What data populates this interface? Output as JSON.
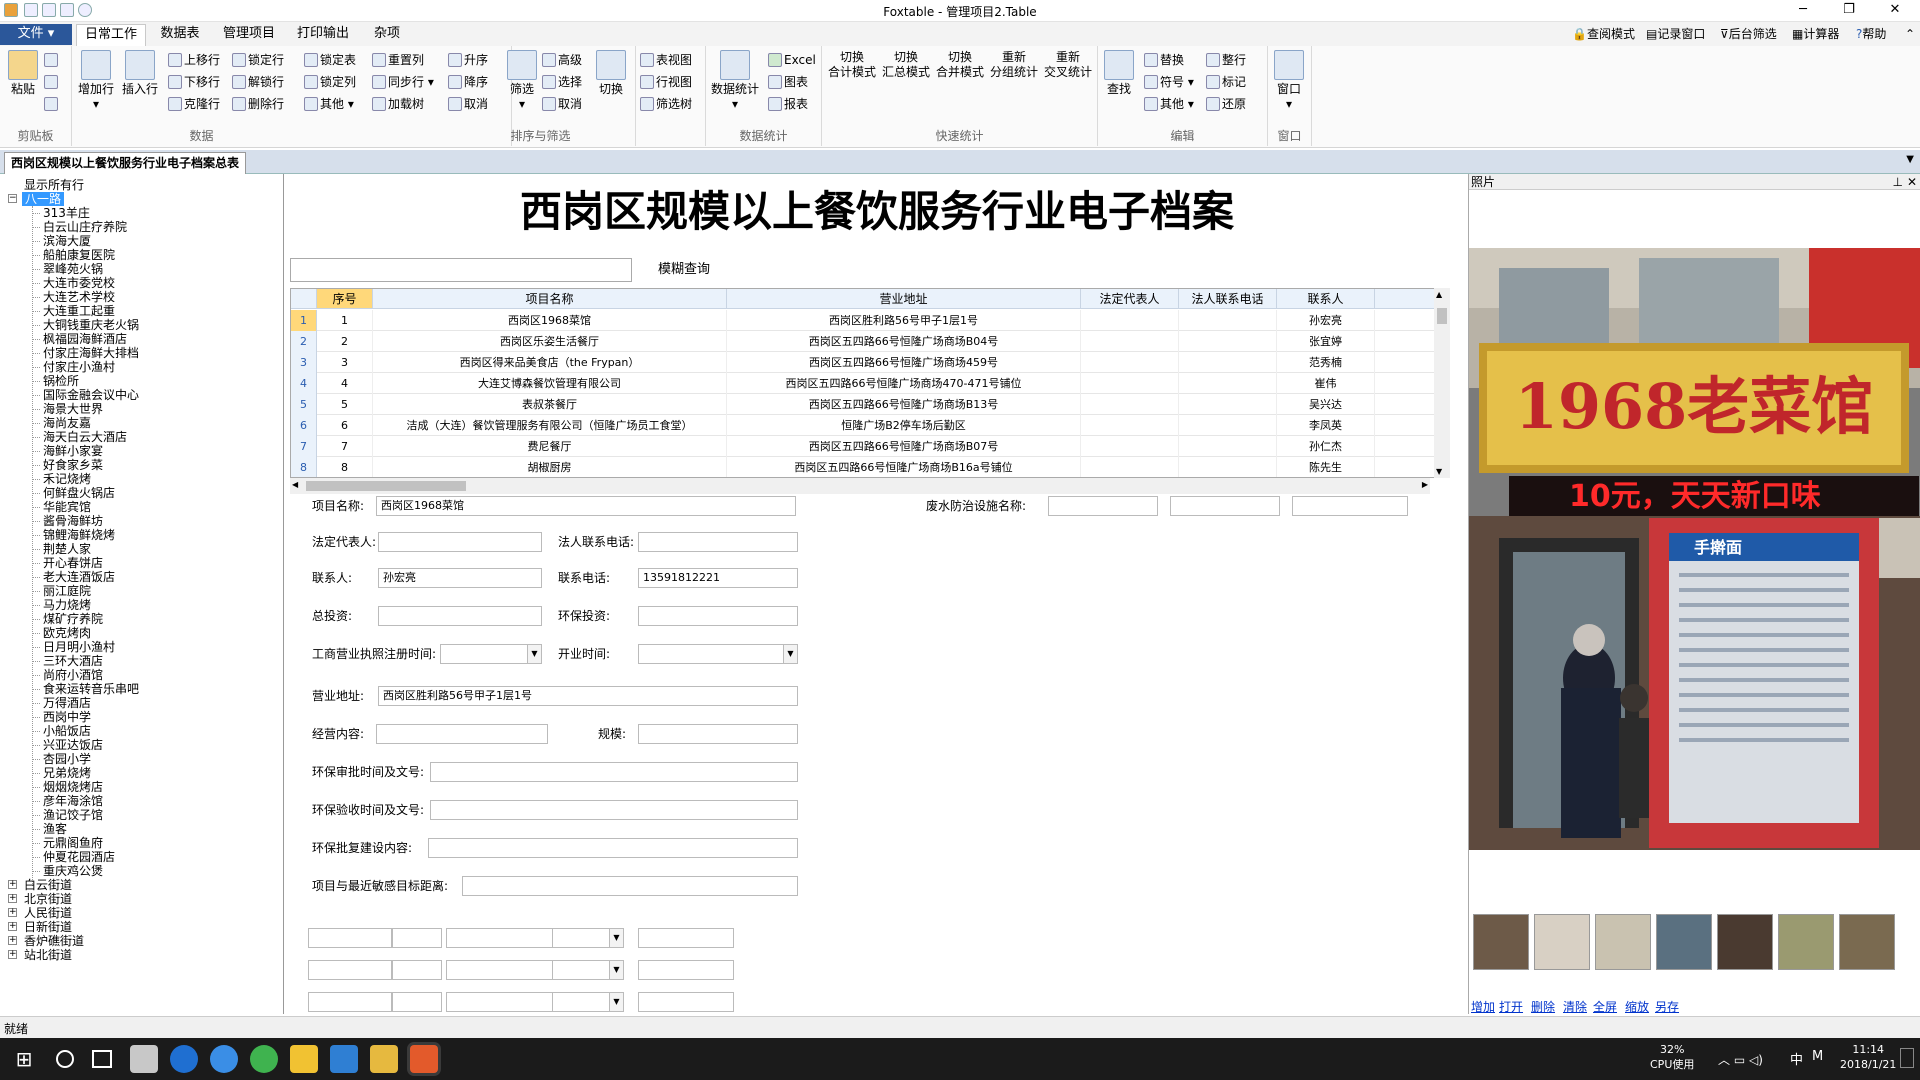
{
  "window": {
    "title": "Foxtable - 管理项目2.Table"
  },
  "tabs": {
    "file": "文件",
    "items": [
      "日常工作",
      "数据表",
      "管理项目",
      "打印输出",
      "杂项"
    ]
  },
  "topright": [
    "查阅模式",
    "记录窗口",
    "后台筛选",
    "计算器",
    "帮助"
  ],
  "ribbon": {
    "clipboard": {
      "label": "剪贴板",
      "paste": "粘贴"
    },
    "data": {
      "label": "数据",
      "add": "增加行",
      "insert": "插入行",
      "items": [
        "上移行",
        "锁定行",
        "锁定表",
        "重置列",
        "下移行",
        "解锁行",
        "锁定列",
        "同步行",
        "克隆行",
        "删除行",
        "其他",
        "加载树"
      ]
    },
    "sort": {
      "label": "排序与筛选",
      "items": [
        "升序",
        "降序",
        "取消",
        "高级",
        "选择",
        "取消"
      ],
      "filter": "筛选",
      "toggle": "切换"
    },
    "view": {
      "items": [
        "表视图",
        "行视图",
        "筛选树"
      ]
    },
    "stats": {
      "label": "数据统计",
      "main": "数据统计",
      "items": [
        "Excel",
        "图表",
        "报表"
      ]
    },
    "quick": {
      "label": "快速统计",
      "btns": [
        "切换\n合计模式",
        "切换\n汇总模式",
        "切换\n合并模式",
        "重新\n分组统计",
        "重新\n交叉统计"
      ]
    },
    "edit": {
      "label": "编辑",
      "find": "查找",
      "items": [
        "替换",
        "整行",
        "符号",
        "标记",
        "其他",
        "还原"
      ]
    },
    "window": {
      "label": "窗口",
      "btn": "窗口"
    }
  },
  "doc_tab": "西岗区规模以上餐饮服务行业电子档案总表",
  "tree": {
    "show_all": "显示所有行",
    "selected": "八一路",
    "children": [
      "313羊庄",
      "白云山庄疗养院",
      "滨海大厦",
      "船舶康复医院",
      "翠峰苑火锅",
      "大连市委党校",
      "大连艺术学校",
      "大连重工起重",
      "大铜钱重庆老火锅",
      "枫福园海鲜酒店",
      "付家庄海鲜大排档",
      "付家庄小渔村",
      "锅检所",
      "国际金融会议中心",
      "海景大世界",
      "海尚友嘉",
      "海天白云大酒店",
      "海鲜小家宴",
      "好食家乡菜",
      "禾记烧烤",
      "何鲜盘火锅店",
      "华能宾馆",
      "酱骨海鲜坊",
      "锦鲤海鲜烧烤",
      "荆楚人家",
      "开心春饼店",
      "老大连酒饭店",
      "丽江庭院",
      "马力烧烤",
      "煤矿疗养院",
      "欧克烤肉",
      "日月明小渔村",
      "三环大酒店",
      "尚府小酒馆",
      "食来运转音乐串吧",
      "万得酒店",
      "西岗中学",
      "小船饭店",
      "兴亚达饭店",
      "杏园小学",
      "兄弟烧烤",
      "烟烟烧烤店",
      "彦年海涂馆",
      "渔记饺子馆",
      "渔客",
      "元鼎阁鱼府",
      "仲夏花园酒店",
      "重庆鸡公煲"
    ],
    "others": [
      "白云街道",
      "北京街道",
      "人民街道",
      "日新街道",
      "香炉礁街道",
      "站北街道"
    ]
  },
  "main": {
    "heading": "西岗区规模以上餐饮服务行业电子档案",
    "search_btn": "模糊查询",
    "grid": {
      "columns": [
        "序号",
        "项目名称",
        "营业地址",
        "法定代表人",
        "法人联系电话",
        "联系人"
      ],
      "rows": [
        [
          "1",
          "西岗区1968菜馆",
          "西岗区胜利路56号甲子1层1号",
          "",
          "",
          "孙宏亮"
        ],
        [
          "2",
          "西岗区乐姿生活餐厅",
          "西岗区五四路66号恒隆广场商场B04号",
          "",
          "",
          "张宜婷"
        ],
        [
          "3",
          "西岗区得来品美食店（the Frypan）",
          "西岗区五四路66号恒隆广场商场459号",
          "",
          "",
          "范秀楠"
        ],
        [
          "4",
          "大连艾博森餐饮管理有限公司",
          "西岗区五四路66号恒隆广场商场470-471号铺位",
          "",
          "",
          "崔伟"
        ],
        [
          "5",
          "表叔茶餐厅",
          "西岗区五四路66号恒隆广场商场B13号",
          "",
          "",
          "吴兴达"
        ],
        [
          "6",
          "洁成（大连）餐饮管理服务有限公司（恒隆广场员工食堂）",
          "恒隆广场B2停车场后勤区",
          "",
          "",
          "李凤英"
        ],
        [
          "7",
          "费尼餐厅",
          "西岗区五四路66号恒隆广场商场B07号",
          "",
          "",
          "孙仁杰"
        ],
        [
          "8",
          "胡椒厨房",
          "西岗区五四路66号恒隆广场商场B16a号铺位",
          "",
          "",
          "陈先生"
        ]
      ]
    },
    "form": {
      "project_name": "项目名称:",
      "project_name_val": "西岗区1968菜馆",
      "waste": "废水防治设施名称:",
      "legal": "法定代表人:",
      "legal_phone": "法人联系电话:",
      "contact": "联系人:",
      "contact_val": "孙宏亮",
      "phone": "联系电话:",
      "phone_val": "13591812221",
      "invest": "总投资:",
      "env_invest": "环保投资:",
      "reg_time": "工商营业执照注册时间:",
      "open_time": "开业时间:",
      "address": "营业地址:",
      "address_val": "西岗区胜利路56号甲子1层1号",
      "content": "经营内容:",
      "scale": "规模:",
      "env_approve": "环保审批时间及文号:",
      "env_accept": "环保验收时间及文号:",
      "env_reply": "环保批复建设内容:",
      "distance": "项目与最近敏感目标距离:"
    }
  },
  "photo_pane": {
    "title": "照片",
    "sign_text": "1968老菜馆",
    "led_text": "10元，天天新口味",
    "menu_title": "手擀面",
    "links": [
      "增加",
      "打开",
      "删除",
      "清除",
      "全屏",
      "缩放",
      "另存"
    ]
  },
  "status": "就绪",
  "taskbar": {
    "cpu": "32%",
    "cpu_label": "CPU使用",
    "time": "11:14",
    "date": "2018/1/21",
    "ime": "中"
  }
}
